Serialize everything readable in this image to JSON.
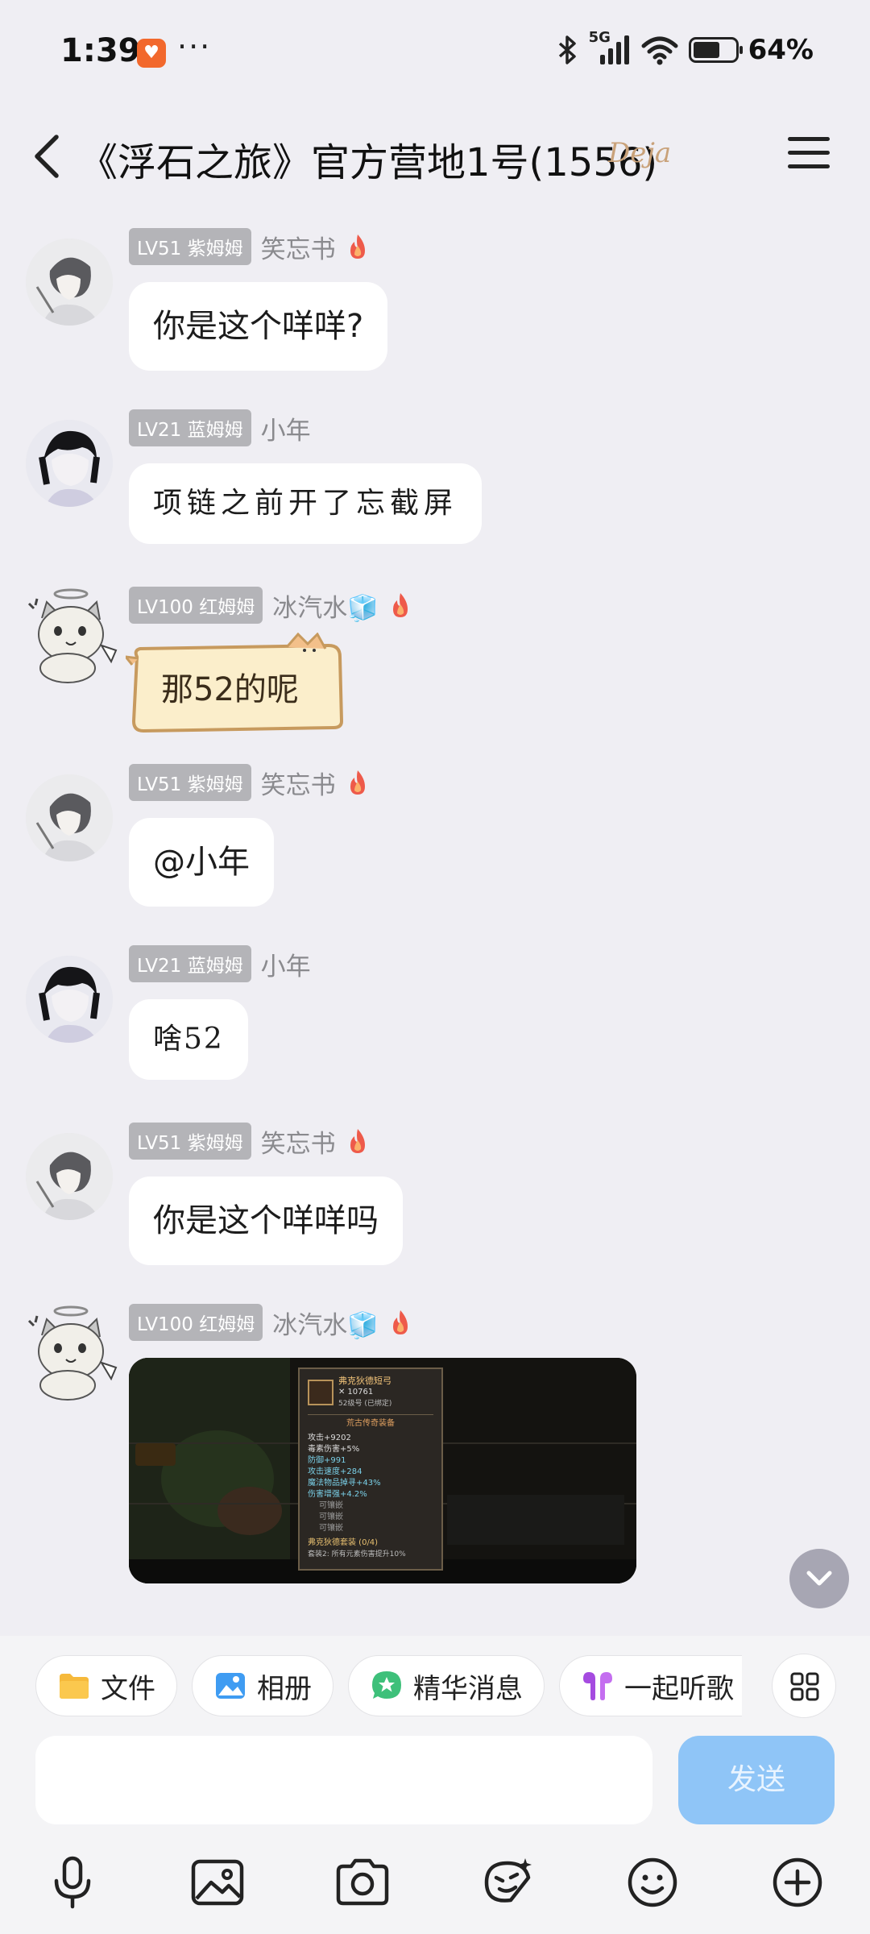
{
  "status_bar": {
    "time": "1:39",
    "app_badge": "♥",
    "dots": "···",
    "network": "5G",
    "battery_percent": "64%",
    "battery_level": 0.64
  },
  "header": {
    "title": "《浮石之旅》官方营地1号(1556)",
    "badge": "Deja"
  },
  "messages": [
    {
      "level": "LV51 紫姆姆",
      "nick": "笑忘书",
      "text": "你是这个咩咩?"
    },
    {
      "level": "LV21 蓝姆姆",
      "nick": "小年",
      "text": "项链之前开了忘截屏"
    },
    {
      "level": "LV100 红姆姆",
      "nick": "冰汽水🧊",
      "text": "那52的呢"
    },
    {
      "level": "LV51 紫姆姆",
      "nick": "笑忘书",
      "text": "@小年"
    },
    {
      "level": "LV21 蓝姆姆",
      "nick": "小年",
      "text": "啥52"
    },
    {
      "level": "LV51 紫姆姆",
      "nick": "笑忘书",
      "text": "你是这个咩咩吗"
    },
    {
      "level": "LV100 红姆姆",
      "nick": "冰汽水🧊",
      "image": "game-screenshot"
    }
  ],
  "game_card": {
    "item_name": "弗克狄德短弓",
    "power": "10761",
    "level_note": "52级号 (已绑定)",
    "section": "荒古传奇装备",
    "stats": [
      "攻击+9202",
      "毒素伤害+5%",
      "防御+991",
      "攻击速度+284",
      "魔法物品掉寻+43%",
      "伤害增强+4.2%"
    ],
    "sockets": [
      "可镶嵌",
      "可镶嵌",
      "可镶嵌"
    ],
    "set_name": "弗克狄德套装 (0/4)",
    "set_bonus": "套装2: 所有元素伤害提升10%"
  },
  "quick_actions": [
    {
      "label": "文件",
      "icon": "folder-icon"
    },
    {
      "label": "相册",
      "icon": "photo-album-icon"
    },
    {
      "label": "精华消息",
      "icon": "star-message-icon"
    },
    {
      "label": "一起听歌",
      "icon": "earbuds-icon"
    }
  ],
  "composer": {
    "placeholder": "",
    "send_label": "发送"
  },
  "toolbar": [
    "microphone-icon",
    "image-icon",
    "camera-icon",
    "sticker-icon",
    "emoji-icon",
    "plus-icon"
  ],
  "colors": {
    "background": "#efeef3",
    "send_button": "#8fc5f7",
    "level_badge": "#b4b4b8"
  }
}
